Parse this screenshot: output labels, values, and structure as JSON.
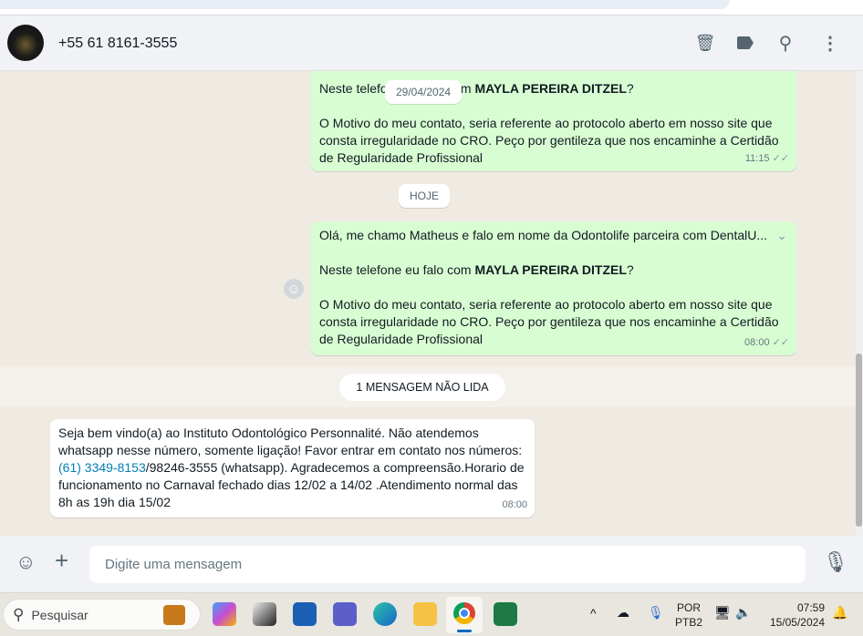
{
  "header": {
    "contact": "+55 61 8161-3555",
    "icons": [
      "archive-icon",
      "label-icon",
      "search-icon",
      "menu-icon"
    ]
  },
  "chat": {
    "date_chip": "29/04/2024",
    "today_chip": "HOJE",
    "msg1": {
      "line1_pre": "Neste telefone eu falo com ",
      "line1_bold": "MAYLA PEREIRA DITZEL",
      "line1_post": "?",
      "l2": "O Motivo do meu contato, seria referente ao protocolo aberto em nosso site que",
      "l3": "consta irregularidade no CRO. Peço por gentileza que nos encaminhe a Certidão",
      "l4": "de Regularidade Profissional",
      "time": "11:15"
    },
    "msg2": {
      "l1": "Olá, me chamo Matheus e falo em nome da Odontolife parceira com DentalU...",
      "line2_pre": "Neste telefone eu falo com ",
      "line2_bold": "MAYLA PEREIRA DITZEL",
      "line2_post": "?",
      "l3": "O Motivo do meu contato, seria referente ao protocolo aberto em nosso site que",
      "l4": "consta irregularidade no CRO. Peço por gentileza que nos encaminhe a Certidão",
      "l5": "de Regularidade Profissional",
      "time": "08:00"
    },
    "unread": "1 MENSAGEM NÃO LIDA",
    "msg3": {
      "l1": "Seja bem vindo(a) ao Instituto Odontológico Personnalité. Não atendemos",
      "l2": "whatsapp nesse número, somente ligação! Favor entrar em contato nos números:",
      "l3_link": "(61) 3349-8153",
      "l3_rest": "/98246-3555 (whatsapp). Agradecemos a compreensão.Horario de",
      "l4": "funcionamento no Carnaval fechado dias 12/02 a 14/02 .Atendimento normal das",
      "l5": "8h as 19h dia 15/02",
      "time": "08:00"
    }
  },
  "footer": {
    "placeholder": "Digite uma mensagem"
  },
  "taskbar": {
    "search": "Pesquisar",
    "lang1": "POR",
    "lang2": "PTB2",
    "time": "07:59",
    "date": "15/05/2024"
  }
}
